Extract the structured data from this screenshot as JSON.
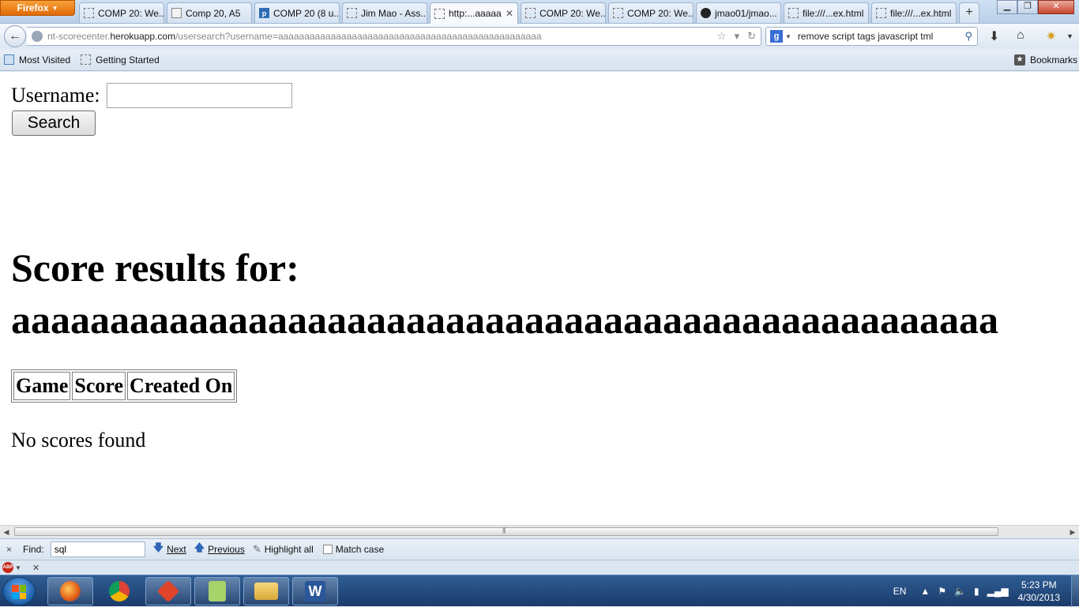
{
  "browser": {
    "app_button": "Firefox",
    "tabs": [
      {
        "label": "COMP 20: We...",
        "icon": "blank-page-icon"
      },
      {
        "label": "Comp 20, A5",
        "icon": "doc-page-icon"
      },
      {
        "label": "COMP 20 (8 u...",
        "icon": "piazza-icon"
      },
      {
        "label": "Jim Mao - Ass...",
        "icon": "blank-page-icon"
      },
      {
        "label": "http:...aaaaa",
        "icon": "blank-page-icon",
        "active": true
      },
      {
        "label": "COMP 20: We...",
        "icon": "blank-page-icon"
      },
      {
        "label": "COMP 20: We...",
        "icon": "blank-page-icon"
      },
      {
        "label": "jmao01/jmao...",
        "icon": "github-icon"
      },
      {
        "label": "file:///...ex.html",
        "icon": "blank-page-icon"
      },
      {
        "label": "file:///...ex.html",
        "icon": "blank-page-icon"
      }
    ],
    "new_tab": "+",
    "url_prefix": "nt-scorecenter.",
    "url_host": "herokuapp.com",
    "url_path": "/usersearch?username=aaaaaaaaaaaaaaaaaaaaaaaaaaaaaaaaaaaaaaaaaaaaaaaaaa",
    "search_engine_letter": "g",
    "search_text": "remove script tags javascript tml",
    "bookmarks": [
      "Most Visited",
      "Getting Started"
    ],
    "bookmarks_menu": "Bookmarks"
  },
  "page": {
    "username_label": "Username:",
    "username_value": "",
    "search_button": "Search",
    "heading_line1": "Score results for:",
    "heading_line2": "aaaaaaaaaaaaaaaaaaaaaaaaaaaaaaaaaaaaaaaaaaaaaaaaaa",
    "table_headers": [
      "Game",
      "Score",
      "Created On"
    ],
    "empty_message": "No scores found"
  },
  "findbar": {
    "close": "×",
    "label": "Find:",
    "query": "sql",
    "next": "Next",
    "previous": "Previous",
    "highlight_all": "Highlight all",
    "match_case": "Match case"
  },
  "taskbar": {
    "language": "EN",
    "time": "5:23 PM",
    "date": "4/30/2013"
  },
  "colors": {
    "accent_firefox": "#e06a06",
    "taskbar": "#1b3b6a"
  }
}
